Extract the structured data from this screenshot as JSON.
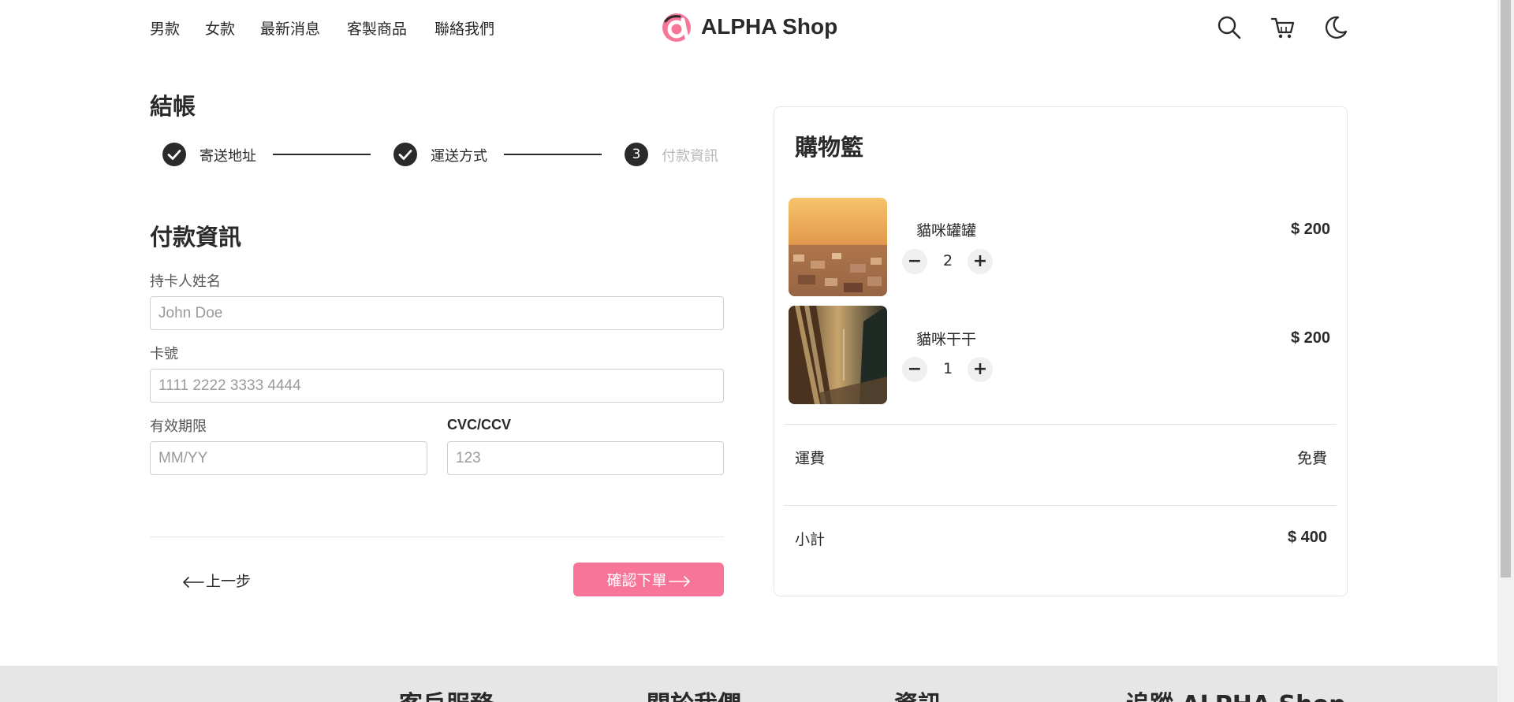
{
  "header": {
    "nav": [
      "男款",
      "女款",
      "最新消息",
      "客製商品",
      "聯絡我們"
    ],
    "logo_text": "ALPHA Shop",
    "icons": [
      "search-icon",
      "cart-icon",
      "moon-icon"
    ]
  },
  "checkout": {
    "title": "結帳",
    "steps": [
      {
        "label": "寄送地址",
        "status": "done"
      },
      {
        "label": "運送方式",
        "status": "done"
      },
      {
        "number": "3",
        "label": "付款資訊",
        "status": "current"
      }
    ],
    "section_title": "付款資訊",
    "fields": {
      "name_label": "持卡人姓名",
      "name_placeholder": "John Doe",
      "card_label": "卡號",
      "card_placeholder": "1111 2222 3333 4444",
      "expiry_label": "有效期限",
      "expiry_placeholder": "MM/YY",
      "cvc_label": "CVC/CCV",
      "cvc_placeholder": "123"
    },
    "prev_label": "上一步",
    "confirm_label": "確認下單"
  },
  "cart": {
    "title": "購物籃",
    "items": [
      {
        "name": "貓咪罐罐",
        "quantity": "2",
        "price": "$ 200"
      },
      {
        "name": "貓咪干干",
        "quantity": "1",
        "price": "$ 200"
      }
    ],
    "shipping_label": "運費",
    "shipping_value": "免費",
    "subtotal_label": "小計",
    "subtotal_value": "$ 400"
  },
  "footer": {
    "headings": [
      "客戶服務",
      "關於我們",
      "資訊",
      "追蹤 ALPHA Shop"
    ]
  },
  "colors": {
    "accent": "#f67599",
    "text": "#2a2a2a",
    "muted": "#b7b7b7",
    "footer_bg": "#e6e6e6"
  }
}
